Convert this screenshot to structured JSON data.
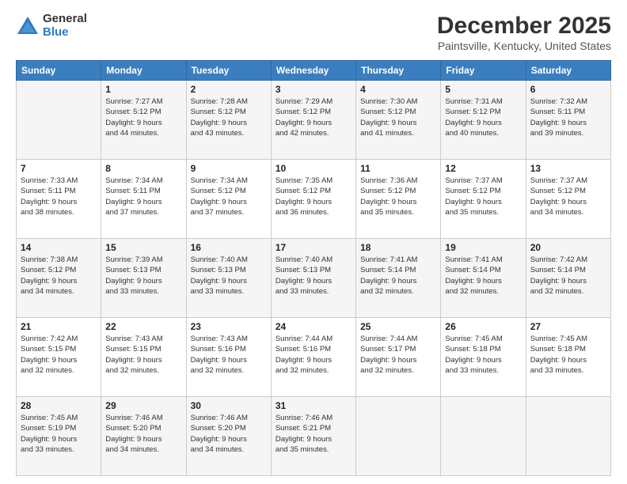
{
  "logo": {
    "general": "General",
    "blue": "Blue"
  },
  "header": {
    "title": "December 2025",
    "subtitle": "Paintsville, Kentucky, United States"
  },
  "weekdays": [
    "Sunday",
    "Monday",
    "Tuesday",
    "Wednesday",
    "Thursday",
    "Friday",
    "Saturday"
  ],
  "weeks": [
    [
      {
        "day": "",
        "info": ""
      },
      {
        "day": "1",
        "info": "Sunrise: 7:27 AM\nSunset: 5:12 PM\nDaylight: 9 hours\nand 44 minutes."
      },
      {
        "day": "2",
        "info": "Sunrise: 7:28 AM\nSunset: 5:12 PM\nDaylight: 9 hours\nand 43 minutes."
      },
      {
        "day": "3",
        "info": "Sunrise: 7:29 AM\nSunset: 5:12 PM\nDaylight: 9 hours\nand 42 minutes."
      },
      {
        "day": "4",
        "info": "Sunrise: 7:30 AM\nSunset: 5:12 PM\nDaylight: 9 hours\nand 41 minutes."
      },
      {
        "day": "5",
        "info": "Sunrise: 7:31 AM\nSunset: 5:12 PM\nDaylight: 9 hours\nand 40 minutes."
      },
      {
        "day": "6",
        "info": "Sunrise: 7:32 AM\nSunset: 5:11 PM\nDaylight: 9 hours\nand 39 minutes."
      }
    ],
    [
      {
        "day": "7",
        "info": "Sunrise: 7:33 AM\nSunset: 5:11 PM\nDaylight: 9 hours\nand 38 minutes."
      },
      {
        "day": "8",
        "info": "Sunrise: 7:34 AM\nSunset: 5:11 PM\nDaylight: 9 hours\nand 37 minutes."
      },
      {
        "day": "9",
        "info": "Sunrise: 7:34 AM\nSunset: 5:12 PM\nDaylight: 9 hours\nand 37 minutes."
      },
      {
        "day": "10",
        "info": "Sunrise: 7:35 AM\nSunset: 5:12 PM\nDaylight: 9 hours\nand 36 minutes."
      },
      {
        "day": "11",
        "info": "Sunrise: 7:36 AM\nSunset: 5:12 PM\nDaylight: 9 hours\nand 35 minutes."
      },
      {
        "day": "12",
        "info": "Sunrise: 7:37 AM\nSunset: 5:12 PM\nDaylight: 9 hours\nand 35 minutes."
      },
      {
        "day": "13",
        "info": "Sunrise: 7:37 AM\nSunset: 5:12 PM\nDaylight: 9 hours\nand 34 minutes."
      }
    ],
    [
      {
        "day": "14",
        "info": "Sunrise: 7:38 AM\nSunset: 5:12 PM\nDaylight: 9 hours\nand 34 minutes."
      },
      {
        "day": "15",
        "info": "Sunrise: 7:39 AM\nSunset: 5:13 PM\nDaylight: 9 hours\nand 33 minutes."
      },
      {
        "day": "16",
        "info": "Sunrise: 7:40 AM\nSunset: 5:13 PM\nDaylight: 9 hours\nand 33 minutes."
      },
      {
        "day": "17",
        "info": "Sunrise: 7:40 AM\nSunset: 5:13 PM\nDaylight: 9 hours\nand 33 minutes."
      },
      {
        "day": "18",
        "info": "Sunrise: 7:41 AM\nSunset: 5:14 PM\nDaylight: 9 hours\nand 32 minutes."
      },
      {
        "day": "19",
        "info": "Sunrise: 7:41 AM\nSunset: 5:14 PM\nDaylight: 9 hours\nand 32 minutes."
      },
      {
        "day": "20",
        "info": "Sunrise: 7:42 AM\nSunset: 5:14 PM\nDaylight: 9 hours\nand 32 minutes."
      }
    ],
    [
      {
        "day": "21",
        "info": "Sunrise: 7:42 AM\nSunset: 5:15 PM\nDaylight: 9 hours\nand 32 minutes."
      },
      {
        "day": "22",
        "info": "Sunrise: 7:43 AM\nSunset: 5:15 PM\nDaylight: 9 hours\nand 32 minutes."
      },
      {
        "day": "23",
        "info": "Sunrise: 7:43 AM\nSunset: 5:16 PM\nDaylight: 9 hours\nand 32 minutes."
      },
      {
        "day": "24",
        "info": "Sunrise: 7:44 AM\nSunset: 5:16 PM\nDaylight: 9 hours\nand 32 minutes."
      },
      {
        "day": "25",
        "info": "Sunrise: 7:44 AM\nSunset: 5:17 PM\nDaylight: 9 hours\nand 32 minutes."
      },
      {
        "day": "26",
        "info": "Sunrise: 7:45 AM\nSunset: 5:18 PM\nDaylight: 9 hours\nand 33 minutes."
      },
      {
        "day": "27",
        "info": "Sunrise: 7:45 AM\nSunset: 5:18 PM\nDaylight: 9 hours\nand 33 minutes."
      }
    ],
    [
      {
        "day": "28",
        "info": "Sunrise: 7:45 AM\nSunset: 5:19 PM\nDaylight: 9 hours\nand 33 minutes."
      },
      {
        "day": "29",
        "info": "Sunrise: 7:46 AM\nSunset: 5:20 PM\nDaylight: 9 hours\nand 34 minutes."
      },
      {
        "day": "30",
        "info": "Sunrise: 7:46 AM\nSunset: 5:20 PM\nDaylight: 9 hours\nand 34 minutes."
      },
      {
        "day": "31",
        "info": "Sunrise: 7:46 AM\nSunset: 5:21 PM\nDaylight: 9 hours\nand 35 minutes."
      },
      {
        "day": "",
        "info": ""
      },
      {
        "day": "",
        "info": ""
      },
      {
        "day": "",
        "info": ""
      }
    ]
  ]
}
